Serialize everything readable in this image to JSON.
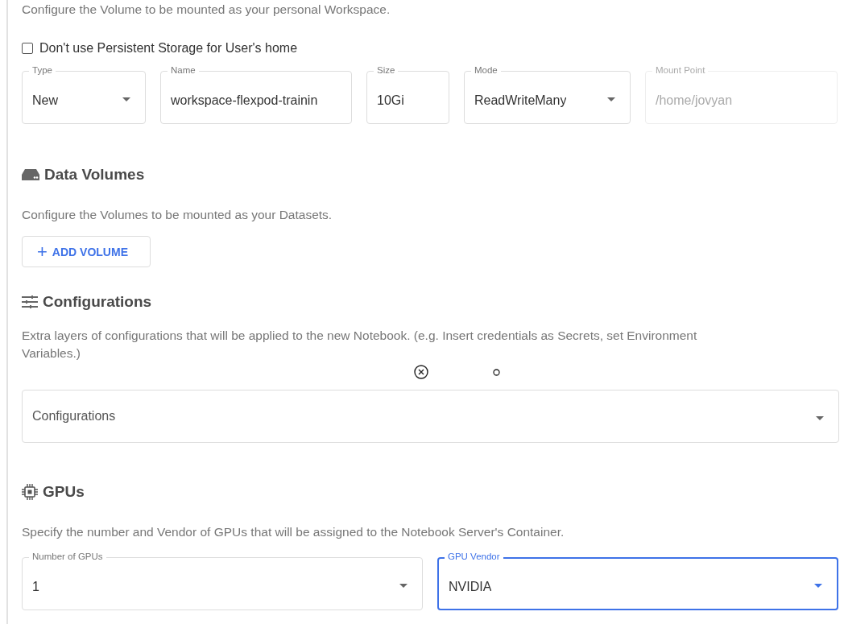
{
  "workspace": {
    "description": "Configure the Volume to be mounted as your personal Workspace.",
    "checkbox": {
      "label": "Don't use Persistent Storage for User's home",
      "checked": false
    },
    "fields": [
      {
        "label": "Type",
        "value": "New",
        "kind": "select",
        "disabled": false
      },
      {
        "label": "Name",
        "value": "workspace-flexpod-trainin",
        "kind": "text",
        "disabled": false
      },
      {
        "label": "Size",
        "value": "10Gi",
        "kind": "text",
        "disabled": false
      },
      {
        "label": "Mode",
        "value": "ReadWriteMany",
        "kind": "select",
        "disabled": false
      },
      {
        "label": "Mount Point",
        "value": "/home/jovyan",
        "kind": "text",
        "disabled": true
      }
    ]
  },
  "data_volumes": {
    "title": "Data Volumes",
    "description": "Configure the Volumes to be mounted as your Datasets.",
    "button": {
      "icon": "+",
      "label": "ADD VOLUME"
    }
  },
  "configurations": {
    "title": "Configurations",
    "description": "Extra layers of configurations that will be applied to the new Notebook. (e.g. Insert credentials as Secrets, set Environment Variables.)",
    "select": {
      "placeholder": "Configurations"
    }
  },
  "gpus": {
    "title": "GPUs",
    "description": "Specify the number and Vendor of GPUs that will be assigned to the Notebook Server's Container.",
    "fields": [
      {
        "label": "Number of GPUs",
        "value": "1",
        "kind": "select",
        "focused": false
      },
      {
        "label": "GPU Vendor",
        "value": "NVIDIA",
        "kind": "select",
        "focused": true
      }
    ]
  }
}
